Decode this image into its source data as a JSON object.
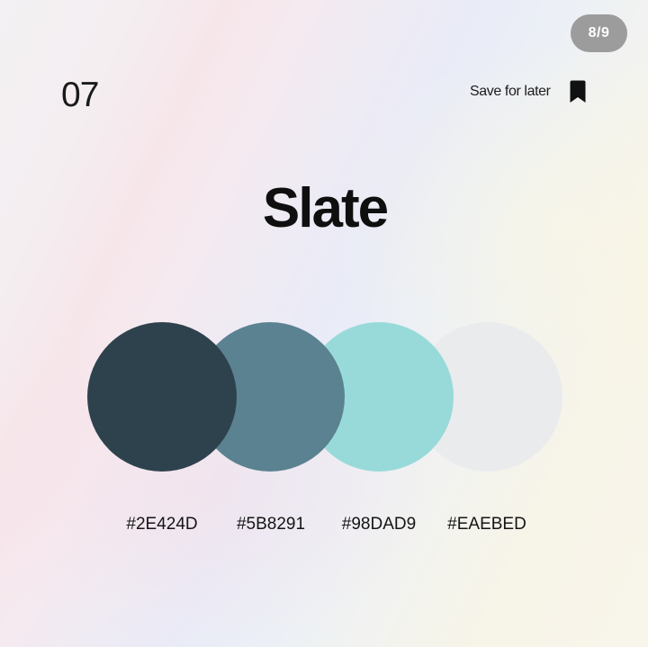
{
  "page_indicator": "8/9",
  "number": "07",
  "save_label": "Save for later",
  "save_icon": "bookmark-icon",
  "palette_name": "Slate",
  "swatches": [
    {
      "hex": "#2E424D",
      "color": "#2E424D"
    },
    {
      "hex": "#5B8291",
      "color": "#5B8291"
    },
    {
      "hex": "#98DAD9",
      "color": "#98DAD9"
    },
    {
      "hex": "#EAEBED",
      "color": "#EAEBED"
    }
  ]
}
